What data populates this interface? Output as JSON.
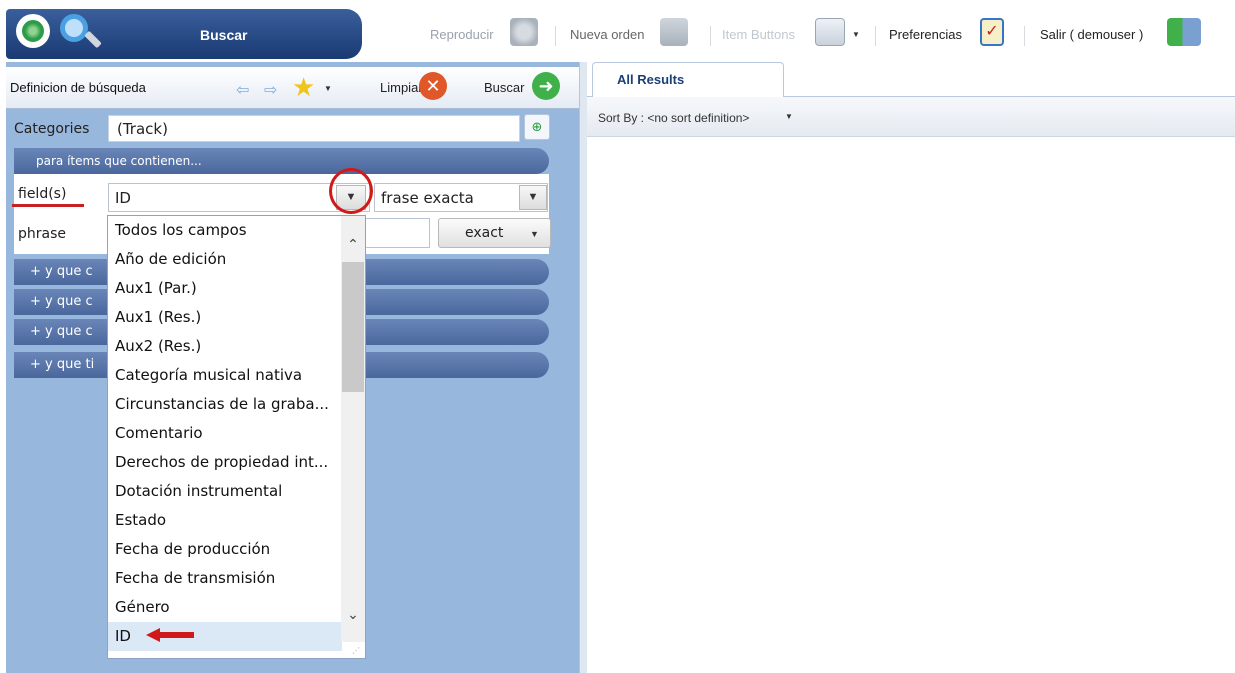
{
  "toolbar": {
    "search_label": "Buscar",
    "play_label": "Reproducir",
    "new_order_label": "Nueva orden",
    "item_buttons_label": "Item Buttons",
    "preferences_label": "Preferencias",
    "logout_label": "Salir ( demouser )"
  },
  "query": {
    "definition_label": "Definicion de búsqueda",
    "clear_label": "Limpiar",
    "search_label": "Buscar",
    "categories_label": "Categories",
    "categories_value": "(Track)",
    "items_containing_label": "para ítems que contienen...",
    "fields_label": "field(s)",
    "field_value": "ID",
    "match_value": "frase exacta",
    "phrase_label": "phrase",
    "exact_label": "exact",
    "extra_rows": [
      "y que c",
      "y que c",
      "y que c",
      "y que ti"
    ]
  },
  "dropdown": {
    "options": [
      "Todos los campos",
      "Año de edición",
      "Aux1 (Par.)",
      "Aux1 (Res.)",
      "Aux2 (Res.)",
      "Categoría musical nativa",
      "Circunstancias de la graba...",
      "Comentario",
      "Derechos de propiedad int...",
      "Dotación instrumental",
      "Estado",
      "Fecha de producción",
      "Fecha de transmisión",
      "Género",
      "ID"
    ],
    "selected": "ID"
  },
  "results": {
    "tab_label": "All Results",
    "sort_label": "Sort By : <no sort definition>"
  },
  "colors": {
    "panel_blue": "#98b7dc",
    "band_blue": "#4a679d",
    "highlight_red": "#d01a1a",
    "tab_text": "#1d3f78"
  }
}
